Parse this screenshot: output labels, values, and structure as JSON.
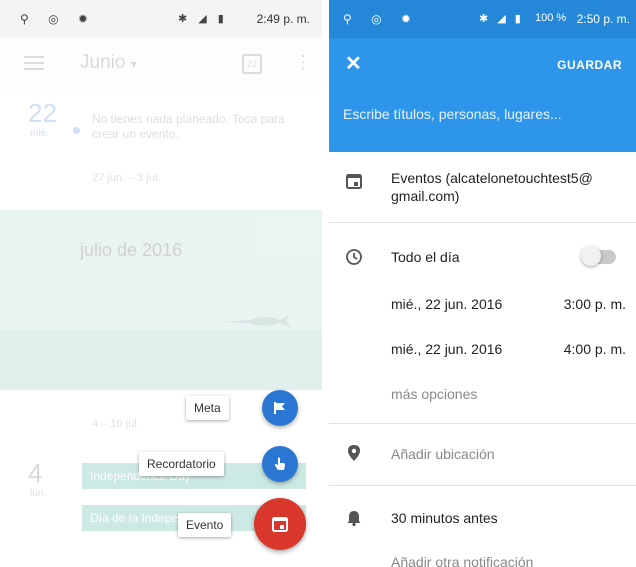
{
  "left": {
    "status": {
      "time": "2:49 p. m."
    },
    "appbar": {
      "month": "Junio",
      "month_arrow": "▾",
      "calendar_day": "22"
    },
    "day22": {
      "number": "22",
      "weekday": "mié."
    },
    "no_plan_text": "No tienes nada planeado. Toca para crear un evento.",
    "range1": "27 jun. – 3 jul.",
    "july_title": "julio de 2016",
    "range2": "4 – 10 jul.",
    "day4": {
      "number": "4",
      "weekday": "lun."
    },
    "events": [
      "Independence Day",
      "Día de la Independencia"
    ],
    "fab_menu": {
      "meta_label": "Meta",
      "reminder_label": "Recordatorio",
      "event_label": "Evento"
    },
    "colors": {
      "blue": "#2b76d2",
      "red": "#d9372b",
      "teal": "#1aa086"
    }
  },
  "right": {
    "status": {
      "battery": "100 %",
      "time": "2:50 p. m."
    },
    "header": {
      "save_label": "GUARDAR",
      "title_placeholder": "Escribe títulos, personas, lugares..."
    },
    "calendar": {
      "line1": "Eventos (alcatelonetouchtest5@",
      "line2": "gmail.com)"
    },
    "all_day": {
      "label": "Todo el día",
      "enabled": false
    },
    "start": {
      "date": "mié., 22 jun. 2016",
      "time": "3:00 p. m."
    },
    "end": {
      "date": "mié., 22 jun. 2016",
      "time": "4:00 p. m."
    },
    "more_options": "más opciones",
    "location_placeholder": "Añadir ubicación",
    "notification": "30 minutos antes",
    "add_notification": "Añadir otra notificación",
    "colors": {
      "header": "#2d96ea",
      "statusbar": "#2487d8"
    }
  }
}
